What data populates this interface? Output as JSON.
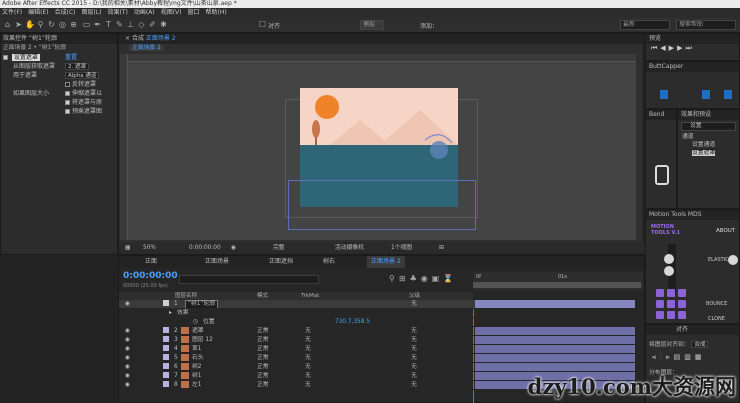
{
  "window": {
    "title": "Adobe After Effects CC 2015 - D:\\我的相关\\素材\\Abby教程\\mg文件\\山茶山泉.aep *"
  },
  "menu": [
    "文件(F)",
    "编辑(E)",
    "合成(C)",
    "图层(L)",
    "效果(T)",
    "动画(A)",
    "视图(V)",
    "窗口",
    "帮助(H)"
  ],
  "toolbar": {
    "snap_label": "对齐",
    "snap_value": "捕捉",
    "add_label": "添加：",
    "workspace": "最新",
    "search_placeholder": "搜索帮助"
  },
  "effect_controls": {
    "tab": "效果控件 “树1”轮廓",
    "header": "正面场景 2 • “树1”轮廓",
    "effect_name": "设置遮罩",
    "reset": "重置",
    "rows": [
      {
        "label": "从图层获取遮罩",
        "value": "2. 遮罩"
      },
      {
        "label": "用于遮罩",
        "value": "Alpha 通道"
      },
      {
        "label": "",
        "value": "反转遮罩",
        "checked": false
      },
      {
        "label": "如果图层大小",
        "value": "伸缩遮罩以",
        "checked": true
      },
      {
        "label": "",
        "value": "将遮罩与原",
        "checked": true
      },
      {
        "label": "",
        "value": "预乘遮罩图",
        "checked": true
      }
    ]
  },
  "composition": {
    "tab": "合成",
    "comp_name": "正面场景 2",
    "breadcrumb": "正面场景 2",
    "zoom": "50%",
    "timecode": "0:00:00:00",
    "resolution": "完整",
    "camera": "活动摄像机",
    "views": "1个视图"
  },
  "timeline": {
    "tabs": [
      "正面",
      "正面场景",
      "正面遮挡",
      "树右",
      "正面场景 2"
    ],
    "current_time": "0:00:00:00",
    "fps": "00000 (25.00 fps)",
    "columns": {
      "name": "图层名称",
      "mode": "模式",
      "trkmat": "TrkMat",
      "parent": "父级"
    },
    "ruler": [
      "0f",
      "01s"
    ],
    "position_label": "位置",
    "position_value": "730.7,358.5",
    "effects_label": "效果",
    "layers": [
      {
        "num": "1",
        "name": "“树1”轮廓",
        "mode": "",
        "trk": "",
        "parent": "无"
      },
      {
        "num": "2",
        "name": "遮罩",
        "mode": "正常",
        "trk": "无",
        "parent": "无"
      },
      {
        "num": "3",
        "name": "图层 12",
        "mode": "正常",
        "trk": "无",
        "parent": "无"
      },
      {
        "num": "4",
        "name": "草1",
        "mode": "正常",
        "trk": "无",
        "parent": "无"
      },
      {
        "num": "5",
        "name": "石头",
        "mode": "正常",
        "trk": "无",
        "parent": "无"
      },
      {
        "num": "6",
        "name": "树2",
        "mode": "正常",
        "trk": "无",
        "parent": "无"
      },
      {
        "num": "7",
        "name": "树1",
        "mode": "正常",
        "trk": "无",
        "parent": "无"
      },
      {
        "num": "8",
        "name": "左1",
        "mode": "正常",
        "trk": "无",
        "parent": "无"
      }
    ]
  },
  "right_panels": {
    "preview_tab": "预览",
    "buttcapper": "ButtCapper",
    "bend": "Bend",
    "effects_tab": "效果和预设",
    "search_value": "设置",
    "tree": [
      "通道",
      "设置通道",
      "设置遮罩"
    ],
    "motion_tools": "Motion Tools MDS",
    "motion_logo": "MOTION TOOLS V.1",
    "about": "ABOUT",
    "elastic": "ELASTIC",
    "bounce": "BOUNCE",
    "clone": "CLONE",
    "align_tab": "对齐",
    "align_to": "将图层对齐到：",
    "align_target": "合成",
    "distribute": "分布图层："
  },
  "watermark": "dzy10.com大资源网",
  "colors": {
    "accent": "#4aa0ff",
    "sky": "#f6d5c6",
    "sea": "#2e6677",
    "sun": "#f0822a",
    "bar": "#6d6fa6",
    "purple": "#8c62d8"
  }
}
